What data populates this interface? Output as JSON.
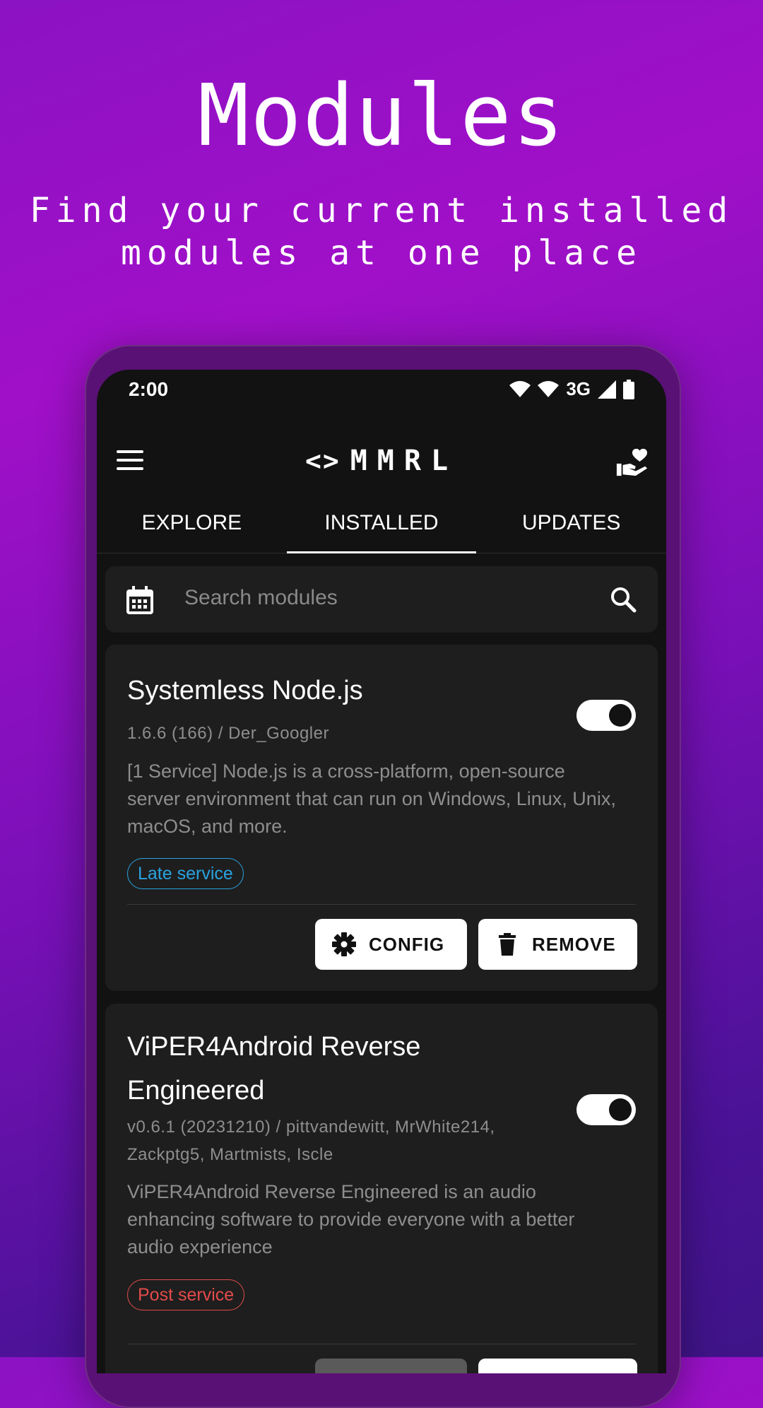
{
  "hero": {
    "title": "Modules",
    "subtitle_line1": "Find your current installed",
    "subtitle_line2": "modules at one place"
  },
  "status_bar": {
    "time": "2:00",
    "network": "3G",
    "icons": [
      "wifi-icon",
      "wifi-icon",
      "signal-icon",
      "battery-icon"
    ]
  },
  "app_bar": {
    "logo_code": "<>",
    "logo_name": "MMRL",
    "left_icon": "menu-icon",
    "right_icon": "donate-heart-hand-icon"
  },
  "tabs": [
    {
      "label": "EXPLORE",
      "active": false
    },
    {
      "label": "INSTALLED",
      "active": true
    },
    {
      "label": "UPDATES",
      "active": false
    }
  ],
  "search": {
    "placeholder": "Search modules",
    "left_icon": "calendar-icon",
    "right_icon": "search-icon"
  },
  "modules": [
    {
      "title": "Systemless Node.js",
      "meta": "1.6.6 (166) / Der_Googler",
      "desc_line1": "[1 Service] Node.js is a cross-platform, open-source",
      "desc_line2": "server environment that can run on Windows, Linux, Unix,",
      "desc_line3": "macOS, and more.",
      "badge": "Late service",
      "badge_color": "#29a3e0",
      "enabled": true,
      "config_label": "CONFIG",
      "remove_label": "REMOVE"
    },
    {
      "title_line1": "ViPER4Android Reverse",
      "title_line2": "Engineered",
      "meta_line1": "v0.6.1 (20231210) / pittvandewitt, MrWhite214,",
      "meta_line2": "Zackptg5, Martmists, Iscle",
      "desc_line1": "ViPER4Android Reverse Engineered is an audio",
      "desc_line2": "enhancing software to provide everyone with a better",
      "desc_line3": "audio experience",
      "badge": "Post service",
      "badge_color": "#e34b4b",
      "enabled": true
    }
  ],
  "colors": {
    "background_top": "#a010c8",
    "background_bottom": "#3f1488",
    "screen": "#121212",
    "card": "#1e1e1e"
  }
}
